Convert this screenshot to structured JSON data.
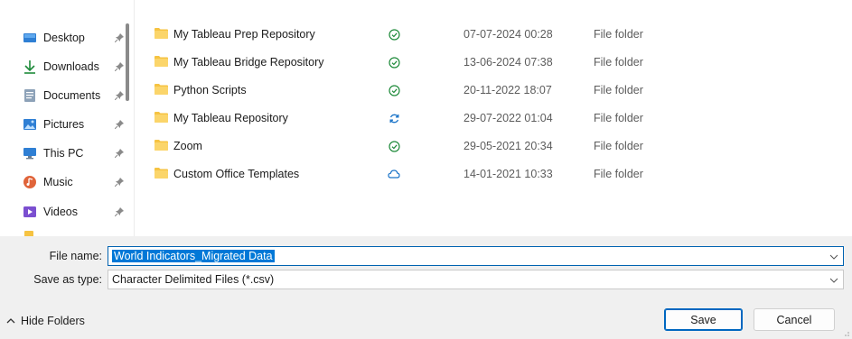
{
  "sidebar": {
    "items": [
      {
        "label": "Desktop",
        "icon": "desktop-icon"
      },
      {
        "label": "Downloads",
        "icon": "downloads-icon"
      },
      {
        "label": "Documents",
        "icon": "documents-icon"
      },
      {
        "label": "Pictures",
        "icon": "pictures-icon"
      },
      {
        "label": "This PC",
        "icon": "this-pc-icon"
      },
      {
        "label": "Music",
        "icon": "music-icon"
      },
      {
        "label": "Videos",
        "icon": "videos-icon"
      }
    ]
  },
  "files": [
    {
      "name": "My Tableau Prep Repository",
      "status": "synced",
      "date": "07-07-2024 00:28",
      "type": "File folder"
    },
    {
      "name": "My Tableau Bridge Repository",
      "status": "synced",
      "date": "13-06-2024 07:38",
      "type": "File folder"
    },
    {
      "name": "Python Scripts",
      "status": "synced",
      "date": "20-11-2022 18:07",
      "type": "File folder"
    },
    {
      "name": "My Tableau Repository",
      "status": "syncing",
      "date": "29-07-2022 01:04",
      "type": "File folder"
    },
    {
      "name": "Zoom",
      "status": "synced",
      "date": "29-05-2021 20:34",
      "type": "File folder"
    },
    {
      "name": "Custom Office Templates",
      "status": "cloud",
      "date": "14-01-2021 10:33",
      "type": "File folder"
    }
  ],
  "form": {
    "filename_label": "File name:",
    "filename_value": "World Indicators_Migrated Data",
    "savetype_label": "Save as type:",
    "savetype_value": "Character Delimited Files (*.csv)"
  },
  "footer": {
    "hide_folders_label": "Hide Folders",
    "save_label": "Save",
    "cancel_label": "Cancel"
  },
  "colors": {
    "accent": "#0067c0",
    "selection": "#0078d7",
    "synced": "#1e8a3a",
    "syncing": "#1a73c8",
    "folder": "#f6c342"
  }
}
